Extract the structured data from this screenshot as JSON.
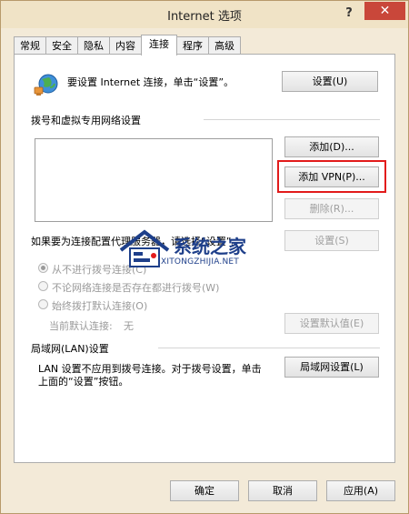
{
  "window": {
    "title": "Internet 选项",
    "help_label": "?",
    "close_label": "✕"
  },
  "tabs": [
    {
      "label": "常规"
    },
    {
      "label": "安全"
    },
    {
      "label": "隐私"
    },
    {
      "label": "内容"
    },
    {
      "label": "连接"
    },
    {
      "label": "程序"
    },
    {
      "label": "高级"
    }
  ],
  "active_tab": "连接",
  "setup": {
    "text": "要设置 Internet 连接，单击“设置”。",
    "button": "设置(U)"
  },
  "dialup": {
    "group_label": "拨号和虚拟专用网络设置",
    "add_button": "添加(D)...",
    "add_vpn_button": "添加 VPN(P)...",
    "delete_button": "删除(R)...",
    "proxy_text": "如果要为连接配置代理服务器，请选择“设置”。",
    "settings_button": "设置(S)",
    "radios": [
      {
        "label": "从不进行拨号连接(C)",
        "checked": true
      },
      {
        "label": "不论网络连接是否存在都进行拨号(W)",
        "checked": false
      },
      {
        "label": "始终拨打默认连接(O)",
        "checked": false
      }
    ],
    "default_label": "当前默认连接:",
    "default_value": "无",
    "set_default_button": "设置默认值(E)"
  },
  "lan": {
    "group_label": "局域网(LAN)设置",
    "text_line1": "LAN 设置不应用到拨号连接。对于拨号设置，单击",
    "text_line2": "上面的“设置”按钮。",
    "button": "局域网设置(L)"
  },
  "footer": {
    "ok": "确定",
    "cancel": "取消",
    "apply": "应用(A)"
  },
  "watermark": {
    "line1": "系统之家",
    "line2": "XITONGZHIJIA.NET"
  },
  "colors": {
    "highlight_border": "#e21b1b",
    "close_button": "#c9473a",
    "title_bar": "#f0e3c6"
  }
}
